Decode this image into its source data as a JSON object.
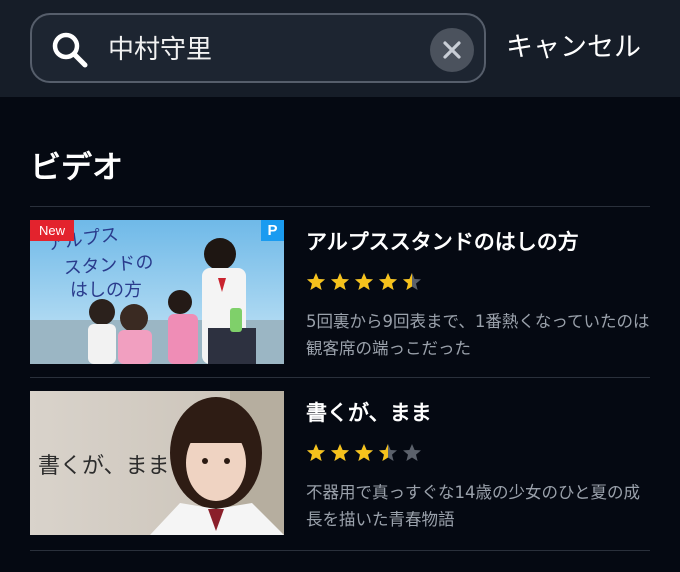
{
  "search": {
    "query": "中村守里",
    "cancel_label": "キャンセル"
  },
  "section": {
    "title": "ビデオ"
  },
  "results": [
    {
      "title": "アルプススタンドのはしの方",
      "badge_new": "New",
      "badge_plan": "P",
      "rating": 4.5,
      "thumb_text": "アルプススタンドのはしの方",
      "desc": "5回裏から9回表まで、1番熱くなっていたのは観客席の端っこだった"
    },
    {
      "title": "書くが、まま",
      "rating": 3.5,
      "thumb_text": "書くが、まま",
      "desc": "不器用で真っすぐな14歳の少女のひと夏の成長を描いた青春物語"
    }
  ],
  "colors": {
    "background": "#050912",
    "topbar": "#161d28",
    "star_filled": "#f6c21c",
    "star_empty": "#5b616b",
    "badge_new": "#e3232d",
    "badge_plan": "#1a9bf0"
  }
}
